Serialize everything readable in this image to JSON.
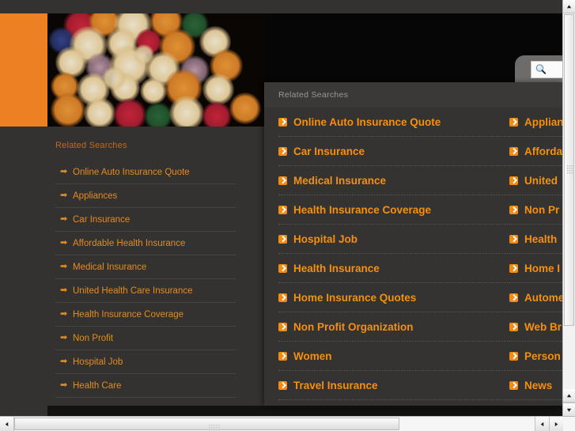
{
  "page": {
    "background_color": "#333231",
    "accent_color": "#ec8022",
    "link_color": "#e58b1e"
  },
  "hero": {
    "orange_block_color": "#ec8022",
    "photo_alt": "bokeh-lights-photo"
  },
  "search": {
    "icon": "magnifier-icon",
    "value": "",
    "placeholder": ""
  },
  "left_panel": {
    "title": "Related Searches",
    "bullet_icon": "right-arrow-icon",
    "items": [
      {
        "label": "Online Auto Insurance Quote"
      },
      {
        "label": "Appliances"
      },
      {
        "label": "Car Insurance"
      },
      {
        "label": "Affordable Health Insurance"
      },
      {
        "label": "Medical Insurance"
      },
      {
        "label": "United Health Care Insurance"
      },
      {
        "label": "Health Insurance Coverage"
      },
      {
        "label": "Non Profit"
      },
      {
        "label": "Hospital Job"
      },
      {
        "label": "Health Care"
      }
    ]
  },
  "overlay_panel": {
    "title": "Related Searches",
    "item_icon": "chevron-right-badge-icon",
    "left_column": [
      {
        "label": "Online Auto Insurance Quote"
      },
      {
        "label": "Car Insurance"
      },
      {
        "label": "Medical Insurance"
      },
      {
        "label": "Health Insurance Coverage"
      },
      {
        "label": "Hospital Job"
      },
      {
        "label": "Health Insurance"
      },
      {
        "label": "Home Insurance Quotes"
      },
      {
        "label": "Non Profit Organization"
      },
      {
        "label": "Women"
      },
      {
        "label": "Travel Insurance"
      }
    ],
    "right_column": [
      {
        "label": "Applian"
      },
      {
        "label": "Afforda"
      },
      {
        "label": "United "
      },
      {
        "label": "Non Pr"
      },
      {
        "label": "Health "
      },
      {
        "label": "Home I"
      },
      {
        "label": "Autome"
      },
      {
        "label": "Web Br"
      },
      {
        "label": "Person"
      },
      {
        "label": "News"
      }
    ]
  },
  "scrollbars": {
    "vertical": {
      "up_arrow": "▲",
      "down_arrow": "▼",
      "grip": "scroll-grip"
    },
    "horizontal": {
      "left_arrow": "◀",
      "right_arrow": "▶",
      "grip": "scroll-grip"
    }
  }
}
